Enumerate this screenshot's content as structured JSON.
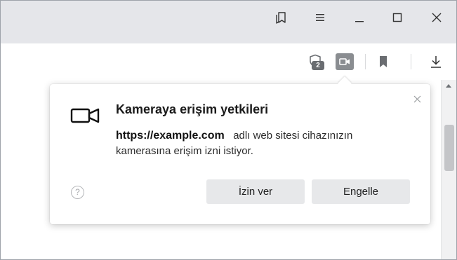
{
  "titlebar": {
    "icons": [
      "collections-icon",
      "menu-icon",
      "minimize-icon",
      "maximize-icon",
      "close-icon"
    ]
  },
  "toolbar": {
    "protect_badge_count": "2",
    "icons": [
      "shield-icon",
      "camera-icon",
      "bookmark-icon",
      "download-icon"
    ]
  },
  "popup": {
    "title": "Kameraya erişim yetkileri",
    "site": "https://example.com",
    "message_part1": "adlı web sitesi cihazınızın",
    "message_part2": "kamerasına erişim izni istiyor.",
    "allow_label": "İzin ver",
    "block_label": "Engelle",
    "help_symbol": "?"
  },
  "colors": {
    "titlebar_bg": "#e5e6ea",
    "button_bg": "#e7e8ea",
    "active_icon_bg": "#8a8d91"
  }
}
